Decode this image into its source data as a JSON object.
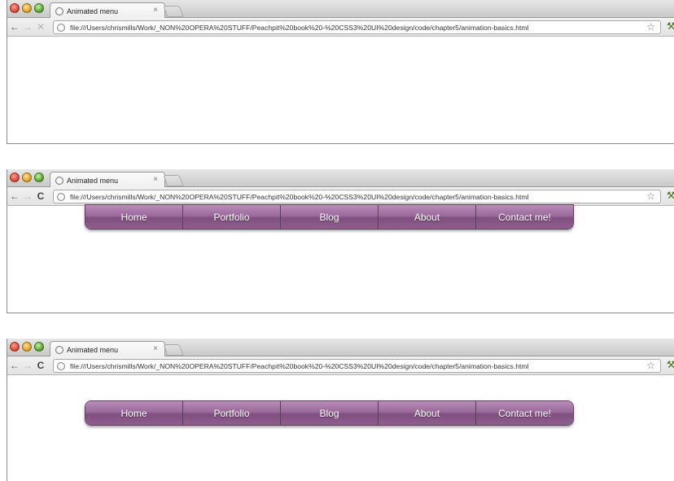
{
  "browser": {
    "tab_title": "Animated menu",
    "tab_close": "×",
    "url": "file:///Users/chrismills/Work/_NON%20OPERA%20STUFF/Peachpit%20book%20-%20CSS3%20UI%20design/code/chapter5/animation-basics.html",
    "back_glyph": "←",
    "forward_glyph": "→",
    "stop_glyph": "✕",
    "reload_glyph": "C",
    "star_glyph": "☆",
    "wrench_glyph": "⚒"
  },
  "menu": {
    "items": [
      "Home",
      "Portfolio",
      "Blog",
      "About",
      "Contact me!"
    ],
    "colors": {
      "top": "#b98cb9",
      "bottom": "#7f4f80",
      "border": "#5c3d5c",
      "text": "#ffffff"
    }
  },
  "frames": [
    {
      "state": "menu-hidden"
    },
    {
      "state": "menu-dropping"
    },
    {
      "state": "menu-settled"
    }
  ],
  "icons": [
    "traffic-light-red",
    "traffic-light-yellow",
    "traffic-light-green",
    "page-icon",
    "back-arrow-icon",
    "forward-arrow-icon",
    "stop-icon",
    "reload-icon",
    "bookmark-star-icon",
    "wrench-icon"
  ]
}
